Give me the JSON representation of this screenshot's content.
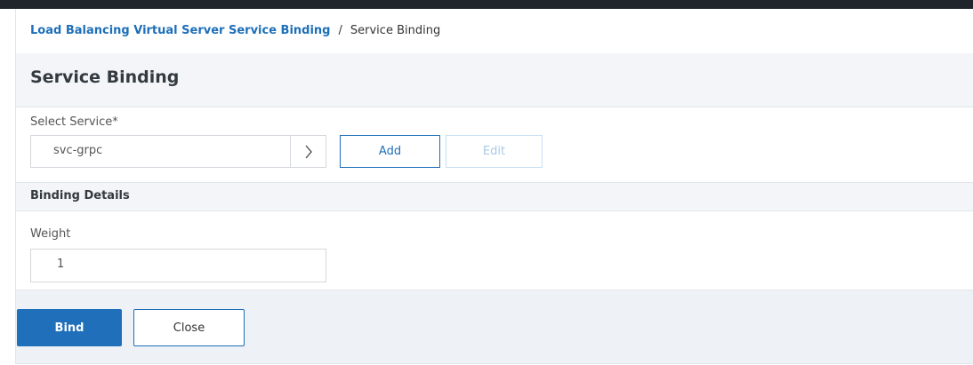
{
  "breadcrumb": {
    "parent": "Load Balancing Virtual Server Service Binding",
    "separator": "/",
    "current": "Service Binding"
  },
  "page": {
    "title": "Service Binding"
  },
  "service": {
    "label": "Select Service*",
    "selected_value": "svc-grpc",
    "arrow_icon": "chevron-right-icon",
    "add_label": "Add",
    "edit_label": "Edit"
  },
  "binding_details": {
    "header": "Binding Details",
    "weight_label": "Weight",
    "weight_value": "1"
  },
  "footer": {
    "bind_label": "Bind",
    "close_label": "Close"
  },
  "colors": {
    "accent": "#1f6fbb",
    "link": "#1d6fb8",
    "topbar": "#20252b",
    "section_bg": "#f3f5f8",
    "disabled_text": "#a8c9e6"
  }
}
